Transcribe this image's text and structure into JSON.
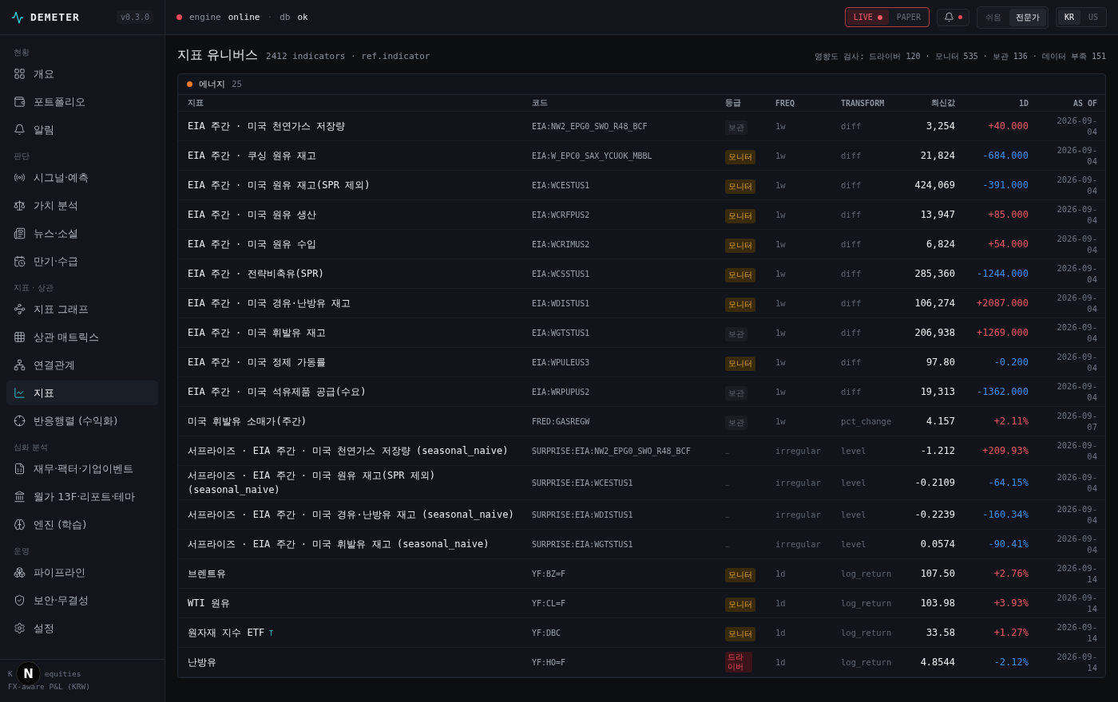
{
  "brand": {
    "name": "DEMETER",
    "version": "v0.3.0"
  },
  "sidebar": {
    "sections": [
      {
        "label": "현황",
        "items": [
          {
            "label": "개요",
            "selected": false
          },
          {
            "label": "포트폴리오",
            "selected": false
          },
          {
            "label": "알림",
            "selected": false
          }
        ]
      },
      {
        "label": "판단",
        "items": [
          {
            "label": "시그널·예측",
            "selected": false
          },
          {
            "label": "가치 분석",
            "selected": false
          },
          {
            "label": "뉴스·소셜",
            "selected": false
          },
          {
            "label": "만기·수급",
            "selected": false
          }
        ]
      },
      {
        "label": "지표 · 상관",
        "items": [
          {
            "label": "지표 그래프",
            "selected": false
          },
          {
            "label": "상관 매트릭스",
            "selected": false
          },
          {
            "label": "연결관계",
            "selected": false
          },
          {
            "label": "지표",
            "selected": true
          },
          {
            "label": "반응행렬 (수익화)",
            "selected": false
          }
        ]
      },
      {
        "label": "심화 분석",
        "items": [
          {
            "label": "재무·팩터·기업이벤트",
            "selected": false
          },
          {
            "label": "월가 13F·리포트·테마",
            "selected": false
          },
          {
            "label": "엔진 (학습)",
            "selected": false
          }
        ]
      },
      {
        "label": "운영",
        "items": [
          {
            "label": "파이프라인",
            "selected": false
          },
          {
            "label": "보안·무결성",
            "selected": false
          },
          {
            "label": "설정",
            "selected": false
          }
        ]
      }
    ],
    "footer": {
      "line_1_start": "K",
      "line_1_end": "equities",
      "line_2": "FX-aware P&L (KRW)"
    },
    "dev_badge": "N"
  },
  "topbar": {
    "status": [
      {
        "label": "engine",
        "value": "online"
      },
      {
        "label": "db",
        "value": "ok"
      }
    ],
    "separator": "·",
    "mode": [
      {
        "label": "LIVE",
        "selected": true
      },
      {
        "label": "PAPER",
        "selected": false
      }
    ],
    "notifications": {
      "unread": true
    },
    "level": [
      {
        "label": "쉬움",
        "selected": false
      },
      {
        "label": "전문가",
        "selected": true
      }
    ],
    "market": [
      {
        "label": "KR",
        "selected": true
      },
      {
        "label": "US",
        "selected": false
      }
    ]
  },
  "page": {
    "title": "지표 유니버스",
    "subtitle": "2412 indicators · ref.indicator",
    "impact": "영향도 검사: 드라이버 120 · 모니터 535 · 보관 136 · 데이터 부족 151"
  },
  "group": {
    "name": "에너지",
    "count": "25",
    "color": "#f07a2a"
  },
  "table": {
    "columns": [
      "지표",
      "코드",
      "등급",
      "FREQ",
      "TRANSFORM",
      "최신값",
      "1D",
      "AS OF"
    ],
    "rows": [
      {
        "name": "EIA 주간 · 미국 천연가스 저장량",
        "code": "EIA:NW2_EPG0_SWO_R48_BCF",
        "grade": {
          "text": "보관",
          "kind": "keep"
        },
        "freq": "1w",
        "transform": "diff",
        "latest": "3,254",
        "change": "+40.000",
        "color": "#f05a66",
        "as_of": "2026-09-04"
      },
      {
        "name": "EIA 주간 · 쿠싱 원유 재고",
        "code": "EIA:W_EPC0_SAX_YCUOK_MBBL",
        "grade": {
          "text": "모니터",
          "kind": "monitor"
        },
        "freq": "1w",
        "transform": "diff",
        "latest": "21,824",
        "change": "-684.000",
        "color": "#3f8ef0",
        "as_of": "2026-09-04"
      },
      {
        "name": "EIA 주간 · 미국 원유 재고(SPR 제외)",
        "code": "EIA:WCESTUS1",
        "grade": {
          "text": "모니터",
          "kind": "monitor"
        },
        "freq": "1w",
        "transform": "diff",
        "latest": "424,069",
        "change": "-391.000",
        "color": "#3f8ef0",
        "as_of": "2026-09-04"
      },
      {
        "name": "EIA 주간 · 미국 원유 생산",
        "code": "EIA:WCRFPUS2",
        "grade": {
          "text": "모니터",
          "kind": "monitor"
        },
        "freq": "1w",
        "transform": "diff",
        "latest": "13,947",
        "change": "+85.000",
        "color": "#f05a66",
        "as_of": "2026-09-04"
      },
      {
        "name": "EIA 주간 · 미국 원유 수입",
        "code": "EIA:WCRIMUS2",
        "grade": {
          "text": "모니터",
          "kind": "monitor"
        },
        "freq": "1w",
        "transform": "diff",
        "latest": "6,824",
        "change": "+54.000",
        "color": "#f05a66",
        "as_of": "2026-09-04"
      },
      {
        "name": "EIA 주간 · 전략비축유(SPR)",
        "code": "EIA:WCSSTUS1",
        "grade": {
          "text": "모니터",
          "kind": "monitor"
        },
        "freq": "1w",
        "transform": "diff",
        "latest": "285,360",
        "change": "-1244.000",
        "color": "#3f8ef0",
        "as_of": "2026-09-04"
      },
      {
        "name": "EIA 주간 · 미국 경유·난방유 재고",
        "code": "EIA:WDISTUS1",
        "grade": {
          "text": "모니터",
          "kind": "monitor"
        },
        "freq": "1w",
        "transform": "diff",
        "latest": "106,274",
        "change": "+2087.000",
        "color": "#f05a66",
        "as_of": "2026-09-04"
      },
      {
        "name": "EIA 주간 · 미국 휘발유 재고",
        "code": "EIA:WGTSTUS1",
        "grade": {
          "text": "보관",
          "kind": "keep"
        },
        "freq": "1w",
        "transform": "diff",
        "latest": "206,938",
        "change": "+1269.000",
        "color": "#f05a66",
        "as_of": "2026-09-04"
      },
      {
        "name": "EIA 주간 · 미국 정제 가동률",
        "code": "EIA:WPULEUS3",
        "grade": {
          "text": "모니터",
          "kind": "monitor"
        },
        "freq": "1w",
        "transform": "diff",
        "latest": "97.80",
        "change": "-0.200",
        "color": "#3f8ef0",
        "as_of": "2026-09-04"
      },
      {
        "name": "EIA 주간 · 미국 석유제품 공급(수요)",
        "code": "EIA:WRPUPUS2",
        "grade": {
          "text": "보관",
          "kind": "keep"
        },
        "freq": "1w",
        "transform": "diff",
        "latest": "19,313",
        "change": "-1362.000",
        "color": "#3f8ef0",
        "as_of": "2026-09-04"
      },
      {
        "name": "미국 휘발유 소매가(주간)",
        "code": "FRED:GASREGW",
        "grade": {
          "text": "보관",
          "kind": "keep"
        },
        "freq": "1w",
        "transform": "pct_change",
        "latest": "4.157",
        "change": "+2.11%",
        "color": "#f05a66",
        "as_of": "2026-09-07"
      },
      {
        "name": "서프라이즈 · EIA 주간 · 미국 천연가스 저장량 (seasonal_naive)",
        "code": "SURPRISE:EIA:NW2_EPG0_SWO_R48_BCF",
        "grade": {
          "text": "–",
          "kind": "none"
        },
        "freq": "irregular",
        "transform": "level",
        "latest": "-1.212",
        "change": "+209.93%",
        "color": "#f05a66",
        "as_of": "2026-09-04"
      },
      {
        "name": "서프라이즈 · EIA 주간 · 미국 원유 재고(SPR 제외) (seasonal_naive)",
        "code": "SURPRISE:EIA:WCESTUS1",
        "grade": {
          "text": "–",
          "kind": "none"
        },
        "freq": "irregular",
        "transform": "level",
        "latest": "-0.2109",
        "change": "-64.15%",
        "color": "#3f8ef0",
        "as_of": "2026-09-04"
      },
      {
        "name": "서프라이즈 · EIA 주간 · 미국 경유·난방유 재고 (seasonal_naive)",
        "code": "SURPRISE:EIA:WDISTUS1",
        "grade": {
          "text": "–",
          "kind": "none"
        },
        "freq": "irregular",
        "transform": "level",
        "latest": "-0.2239",
        "change": "-160.34%",
        "color": "#3f8ef0",
        "as_of": "2026-09-04"
      },
      {
        "name": "서프라이즈 · EIA 주간 · 미국 휘발유 재고 (seasonal_naive)",
        "code": "SURPRISE:EIA:WGTSTUS1",
        "grade": {
          "text": "–",
          "kind": "none"
        },
        "freq": "irregular",
        "transform": "level",
        "latest": "0.0574",
        "change": "-90.41%",
        "color": "#3f8ef0",
        "as_of": "2026-09-04"
      },
      {
        "name": "브렌트유",
        "code": "YF:BZ=F",
        "grade": {
          "text": "모니터",
          "kind": "monitor"
        },
        "freq": "1d",
        "transform": "log_return",
        "latest": "107.50",
        "change": "+2.76%",
        "color": "#f05a66",
        "as_of": "2026-09-14"
      },
      {
        "name": "WTI 원유",
        "code": "YF:CL=F",
        "grade": {
          "text": "모니터",
          "kind": "monitor"
        },
        "freq": "1d",
        "transform": "log_return",
        "latest": "103.98",
        "change": "+3.93%",
        "color": "#f05a66",
        "as_of": "2026-09-14"
      },
      {
        "name": "원자재 지수 ETF",
        "tag": "T",
        "code": "YF:DBC",
        "grade": {
          "text": "모니터",
          "kind": "monitor"
        },
        "freq": "1d",
        "transform": "log_return",
        "latest": "33.58",
        "change": "+1.27%",
        "color": "#f05a66",
        "as_of": "2026-09-14"
      },
      {
        "name": "난방유",
        "code": "YF:HO=F",
        "grade": {
          "text": "드라이버",
          "kind": "driver"
        },
        "freq": "1d",
        "transform": "log_return",
        "latest": "4.8544",
        "change": "-2.12%",
        "color": "#3f8ef0",
        "as_of": "2026-09-14"
      }
    ]
  }
}
